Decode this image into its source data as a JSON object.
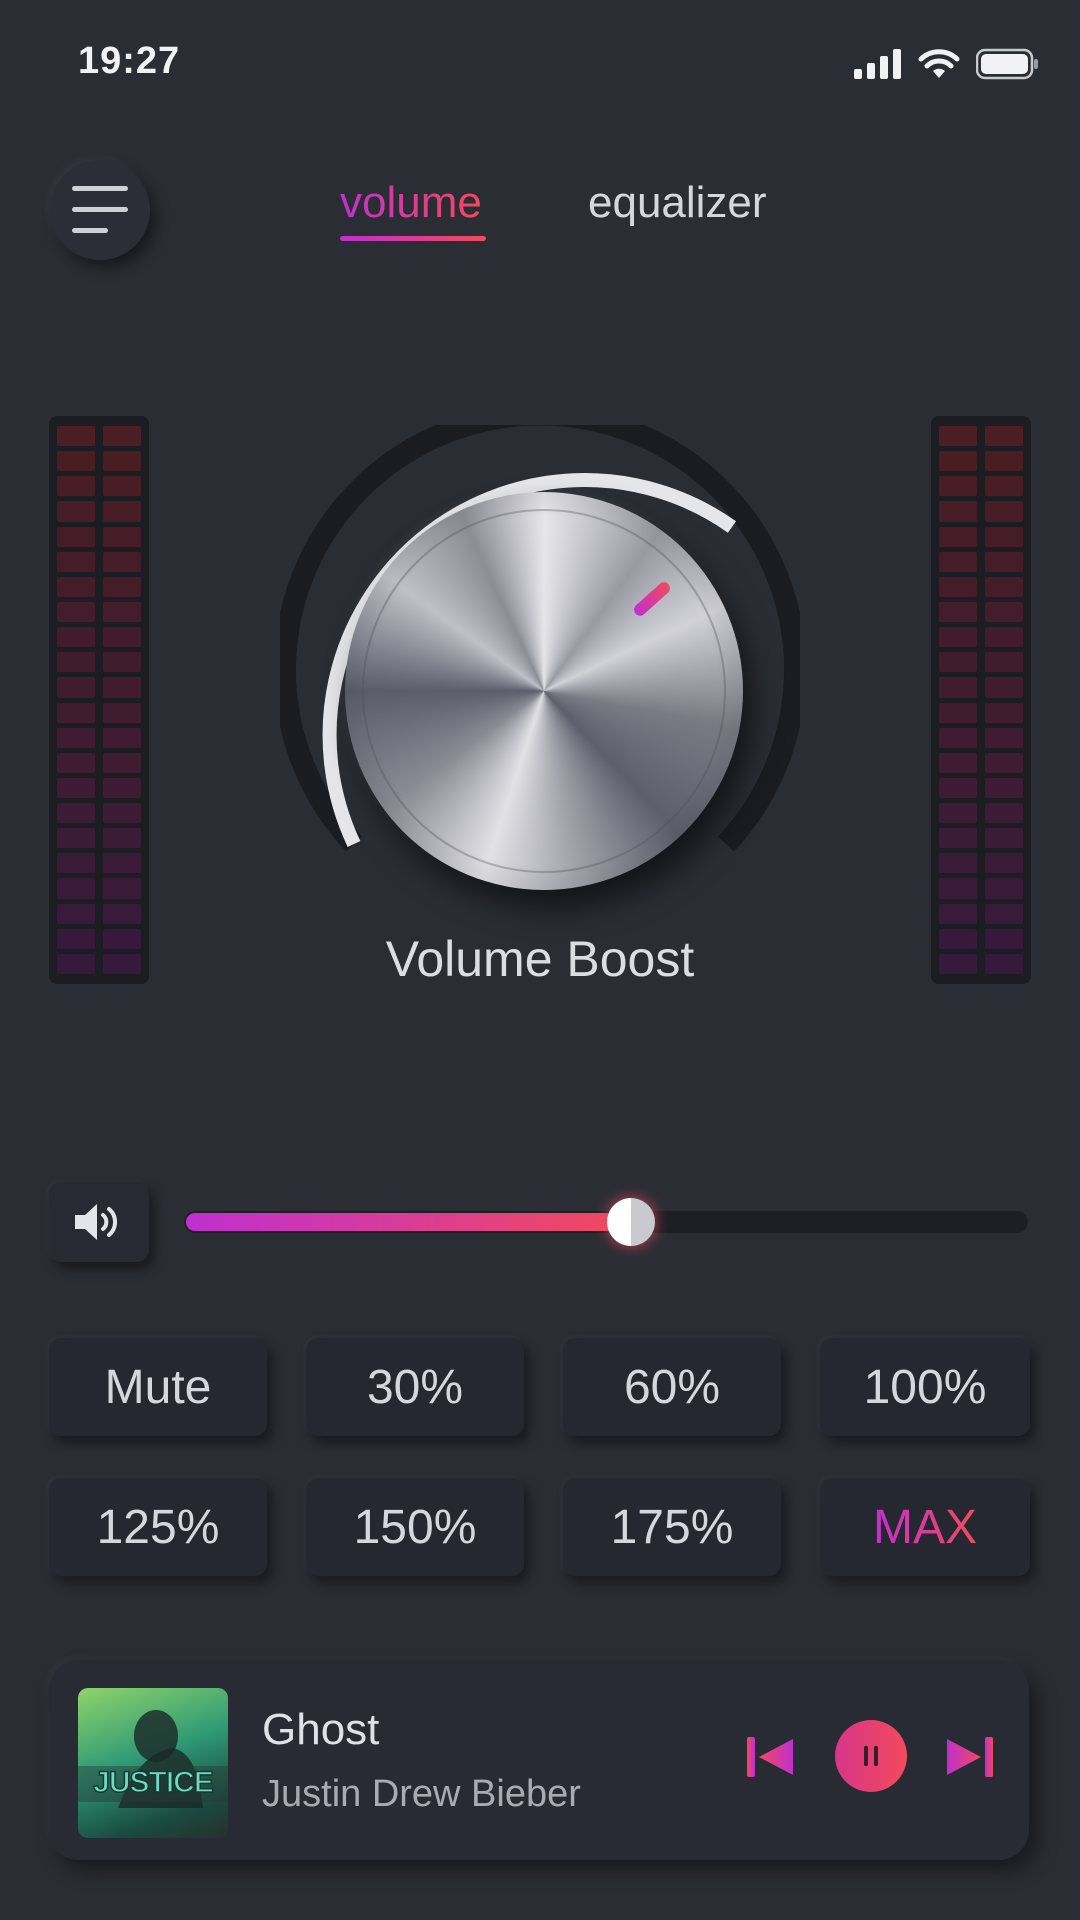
{
  "status_bar": {
    "time": "19:27"
  },
  "tabs": [
    {
      "label": "volume",
      "active": true
    },
    {
      "label": "equalizer",
      "active": false
    }
  ],
  "knob": {
    "label": "Volume Boost"
  },
  "slider": {
    "level": 0.53
  },
  "presets": {
    "row1": [
      "Mute",
      "30%",
      "60%",
      "100%"
    ],
    "row2": [
      "125%",
      "150%",
      "175%",
      "MAX"
    ]
  },
  "player": {
    "title": "Ghost",
    "artist": "Justin Drew Bieber",
    "album_art_text": "JUSTICE"
  },
  "colors": {
    "background": "#2b2d35",
    "accent_start": "#c02fd0",
    "accent_end": "#f24a5c"
  },
  "icons": [
    "signal-icon",
    "wifi-icon",
    "battery-icon",
    "menu-icon",
    "speaker-icon",
    "previous-icon",
    "pause-icon",
    "next-icon"
  ]
}
